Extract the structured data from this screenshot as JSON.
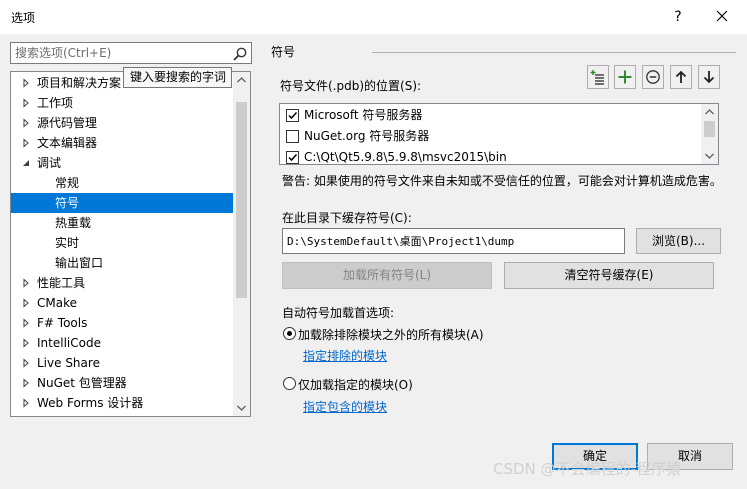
{
  "window": {
    "title": "选项",
    "help": "?"
  },
  "search": {
    "placeholder": "搜索选项(Ctrl+E)",
    "value": ""
  },
  "tooltip": "键入要搜索的字词",
  "tree": {
    "items": [
      {
        "label": "项目和解决方案",
        "arrow": "right"
      },
      {
        "label": "工作项",
        "arrow": "right"
      },
      {
        "label": "源代码管理",
        "arrow": "right"
      },
      {
        "label": "文本编辑器",
        "arrow": "right"
      },
      {
        "label": "调试",
        "arrow": "down"
      },
      {
        "label": "常规",
        "arrow": "none"
      },
      {
        "label": "符号",
        "arrow": "none",
        "selected": true
      },
      {
        "label": "热重载",
        "arrow": "none"
      },
      {
        "label": "实时",
        "arrow": "none"
      },
      {
        "label": "输出窗口",
        "arrow": "none"
      },
      {
        "label": "性能工具",
        "arrow": "right"
      },
      {
        "label": "CMake",
        "arrow": "right"
      },
      {
        "label": "F# Tools",
        "arrow": "right"
      },
      {
        "label": "IntelliCode",
        "arrow": "right"
      },
      {
        "label": "Live Share",
        "arrow": "right"
      },
      {
        "label": "NuGet 包管理器",
        "arrow": "right"
      },
      {
        "label": "Web Forms 设计器",
        "arrow": "right"
      }
    ]
  },
  "panel": {
    "section_title": "符号",
    "symbol_files_label": "符号文件(.pdb)的位置(S):",
    "symbol_sources": [
      {
        "label": "Microsoft 符号服务器",
        "checked": true
      },
      {
        "label": "NuGet.org 符号服务器",
        "checked": false
      },
      {
        "label": "C:\\Qt\\Qt5.9.8\\5.9.8\\msvc2015\\bin",
        "checked": true
      }
    ],
    "warning": "警告: 如果使用的符号文件来自未知或不受信任的位置，可能会对计算机造成危害。",
    "cache_label": "在此目录下缓存符号(C):",
    "cache_path": "D:\\SystemDefault\\桌面\\Project1\\dump",
    "browse": "浏览(B)...",
    "load_all": "加载所有符号(L)",
    "clear_cache": "清空符号缓存(E)",
    "auto_load_label": "自动符号加载首选项:",
    "option_all": "加载除排除模块之外的所有模块(A)",
    "link_excluded": "指定排除的模块",
    "option_specified": "仅加载指定的模块(O)",
    "link_included": "指定包含的模块",
    "selected_option": "option_all"
  },
  "footer": {
    "ok": "确定",
    "cancel": "取消"
  },
  "watermark": "CSDN @不会编程的-程序猿",
  "colors": {
    "selection": "#0078d7",
    "link": "#0066cc",
    "add_icon": "#2e8b2e"
  }
}
